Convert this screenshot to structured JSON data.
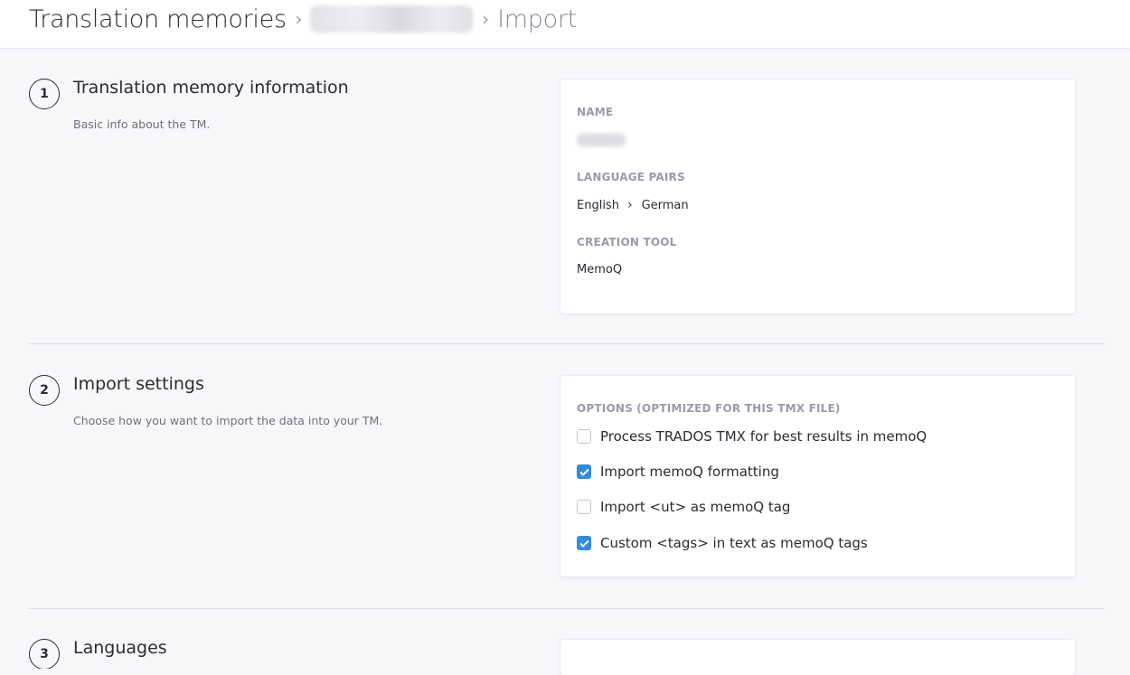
{
  "header": {
    "breadcrumb_root": "Translation memories",
    "breadcrumb_sep_icon": "chevron-right-icon",
    "breadcrumb_current": "Import"
  },
  "sections": [
    {
      "number": "1",
      "title": "Translation memory information",
      "description": "Basic info about the TM.",
      "card": {
        "name_label": "NAME",
        "language_pairs_label": "LANGUAGE PAIRS",
        "source_language": "English",
        "target_language": "German",
        "creation_tool_label": "CREATION TOOL",
        "creation_tool_value": "MemoQ"
      }
    },
    {
      "number": "2",
      "title": "Import settings",
      "description": "Choose how you want to import the data into your TM.",
      "card": {
        "options_label": "OPTIONS (OPTIMIZED FOR THIS TMX FILE)",
        "options": [
          {
            "label": "Process TRADOS TMX for best results in memoQ",
            "checked": false
          },
          {
            "label": "Import memoQ formatting",
            "checked": true
          },
          {
            "label": "Import <ut> as memoQ tag",
            "checked": false
          },
          {
            "label": "Custom <tags> in text as memoQ tags",
            "checked": true
          }
        ]
      }
    },
    {
      "number": "3",
      "title": "Languages"
    }
  ],
  "colors": {
    "accent": "#2f8ddb",
    "background": "#f7f7fa",
    "text": "#2b2b33",
    "muted": "#9a9aaa"
  }
}
